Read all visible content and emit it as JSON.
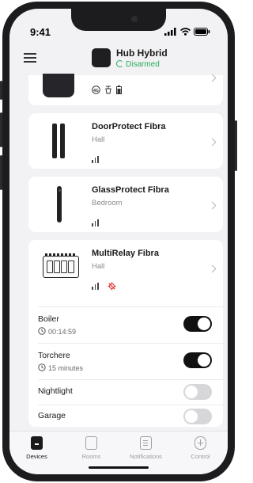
{
  "status_bar": {
    "time": "9:41"
  },
  "header": {
    "hub_name": "Hub Hybrid",
    "hub_status": "Disarmed"
  },
  "devices": [
    {
      "name": "DoorProtect Fibra",
      "room": "Hall"
    },
    {
      "name": "GlassProtect Fibra",
      "room": "Bedroom"
    },
    {
      "name": "MultiRelay Fibra",
      "room": "Hall"
    }
  ],
  "relay_channels": [
    {
      "label": "Boiler",
      "timer": "00:14:59",
      "on": true
    },
    {
      "label": "Torchere",
      "timer": "15 minutes",
      "on": true
    },
    {
      "label": "Nightlight",
      "on": false
    },
    {
      "label": "Garage",
      "on": false
    }
  ],
  "bottom_nav": [
    "Devices",
    "Rooms",
    "Notifications",
    "Control"
  ],
  "colors": {
    "disarmed_green": "#27ae60",
    "alert_red": "#e53935",
    "toggle_on": "#111111",
    "toggle_off": "#d7d7da"
  },
  "icons": [
    "menu-icon",
    "chevron-right-icon",
    "timer-icon",
    "signal-icon",
    "temperature-alert-icon",
    "devices-icon",
    "rooms-icon",
    "notifications-icon",
    "control-icon"
  ]
}
